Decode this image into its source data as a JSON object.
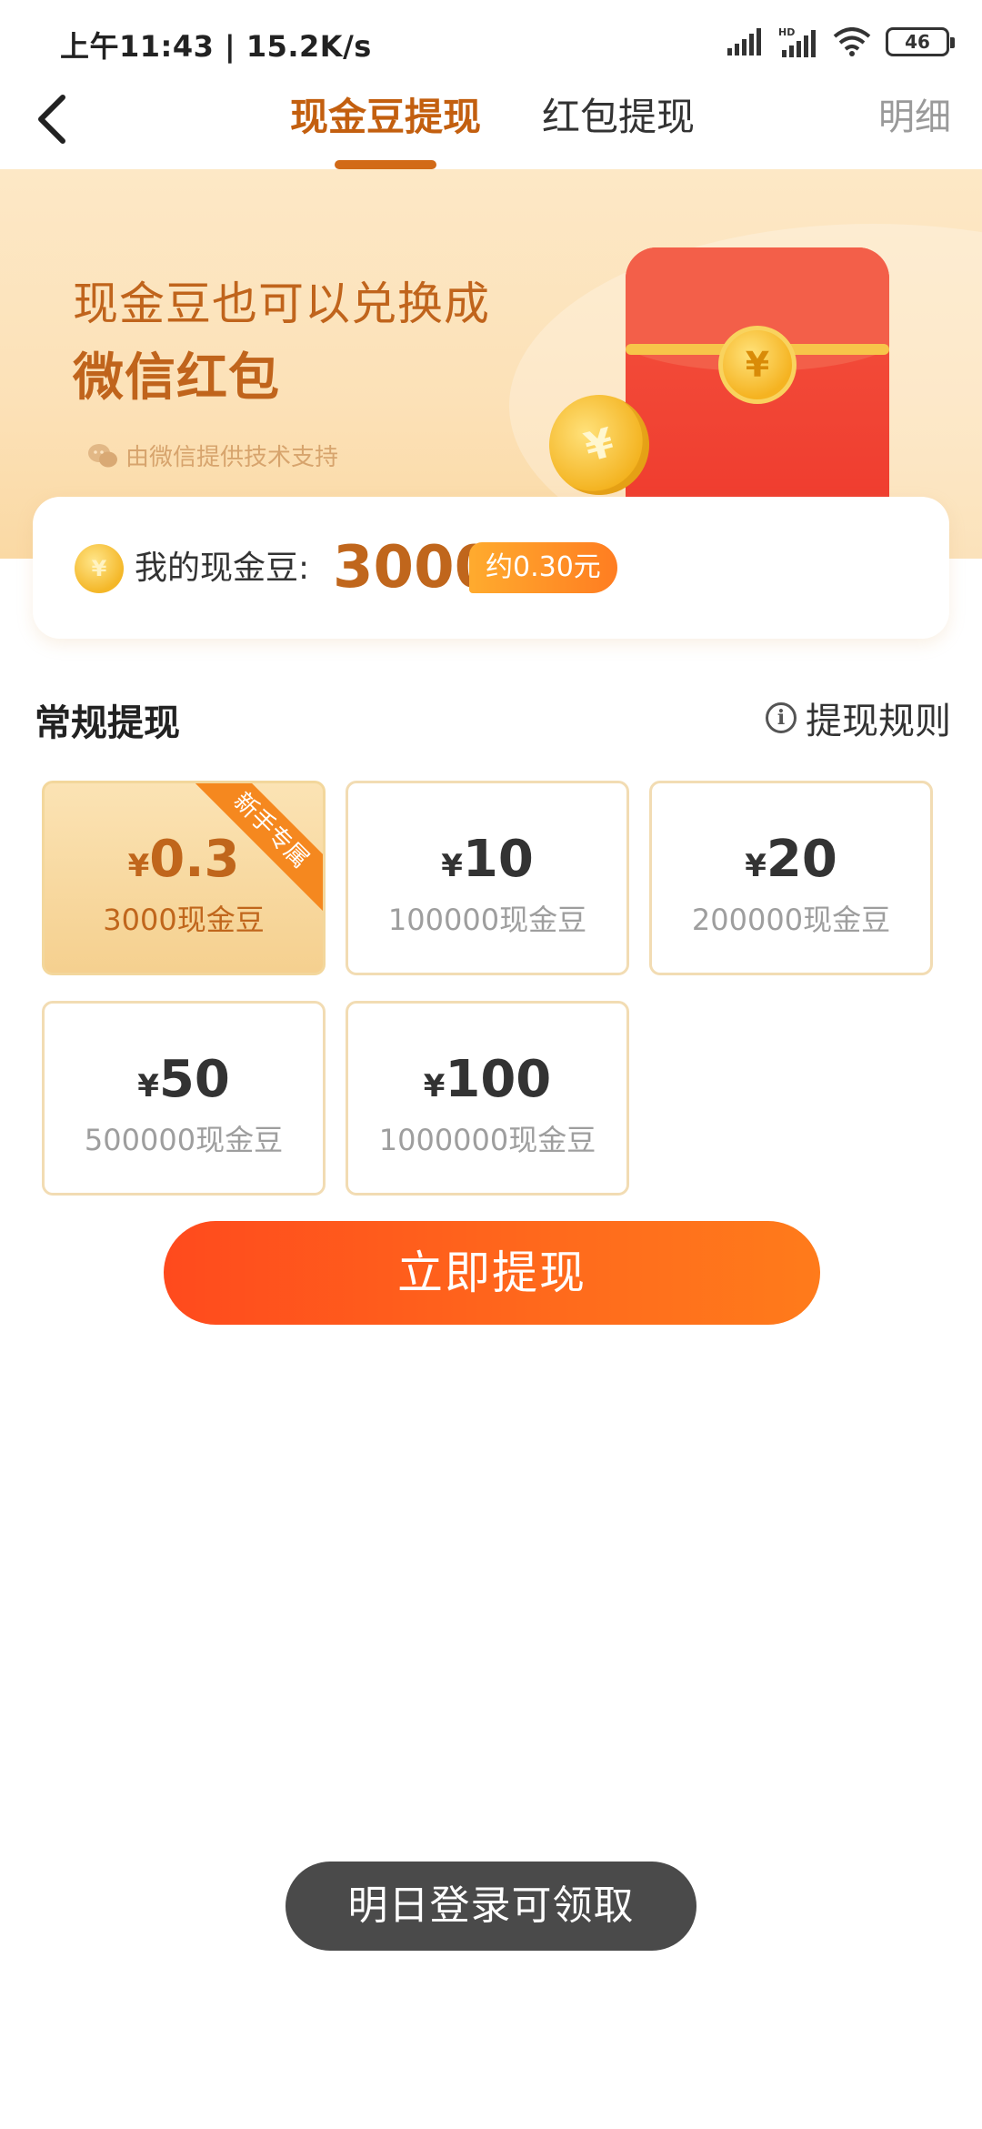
{
  "status_bar": {
    "time": "上午11:43 | 15.2K/s",
    "battery": "46",
    "icons": [
      "signal-icon",
      "hd-signal-icon",
      "wifi-icon",
      "battery-icon"
    ]
  },
  "nav": {
    "tabs": [
      {
        "label": "现金豆提现",
        "active": true
      },
      {
        "label": "红包提现",
        "active": false
      }
    ],
    "detail_label": "明细"
  },
  "banner": {
    "line1": "现金豆也可以兑换成",
    "line2": "微信红包",
    "support": "由微信提供技术支持"
  },
  "balance": {
    "label": "我的现金豆:",
    "value": "3000",
    "approx": "约0.30元"
  },
  "section": {
    "title": "常规提现",
    "rules_label": "提现规则"
  },
  "options": [
    {
      "currency": "¥",
      "amount": "0.3",
      "beans": "3000现金豆",
      "selected": true,
      "ribbon": "新手专属"
    },
    {
      "currency": "¥",
      "amount": "10",
      "beans": "100000现金豆",
      "selected": false
    },
    {
      "currency": "¥",
      "amount": "20",
      "beans": "200000现金豆",
      "selected": false
    },
    {
      "currency": "¥",
      "amount": "50",
      "beans": "500000现金豆",
      "selected": false
    },
    {
      "currency": "¥",
      "amount": "100",
      "beans": "1000000现金豆",
      "selected": false
    }
  ],
  "cta_label": "立即提现",
  "toast": "明日登录可领取",
  "colors": {
    "accent": "#c0661c",
    "cta_start": "#ff4a1d",
    "cta_end": "#ff7b1b",
    "ribbon": "#f5881f",
    "red_envelope": "#ef3b2e"
  }
}
